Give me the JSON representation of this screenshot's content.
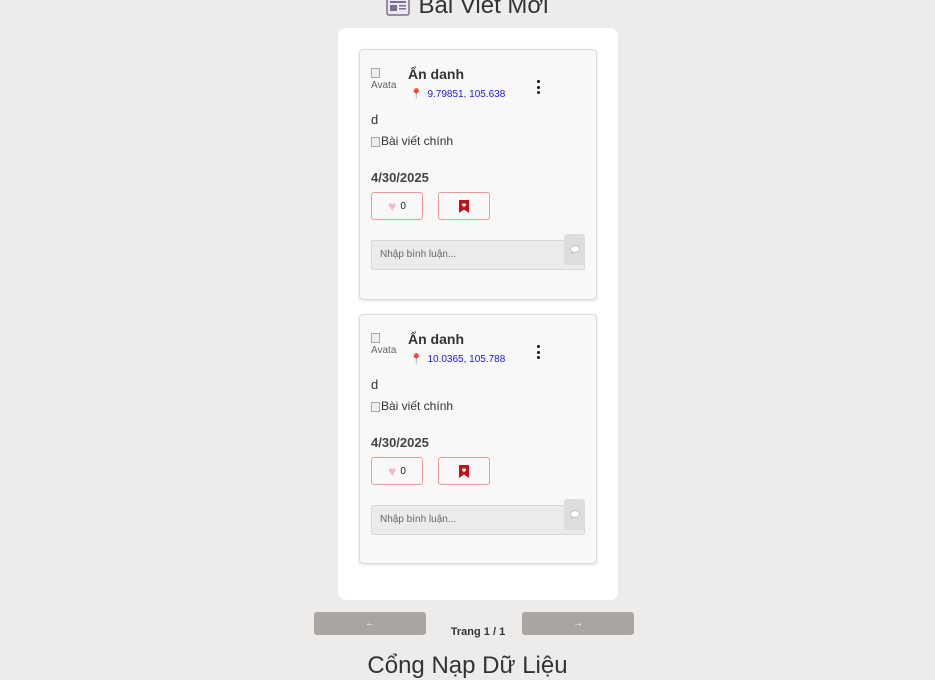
{
  "header": {
    "title": "Bài Viết Mới",
    "icon": "newspaper-icon"
  },
  "posts": [
    {
      "avatar_alt": "Avata",
      "author": "Ẩn danh",
      "location": "9.79851, 105.638",
      "content": "d",
      "image_alt": "Bài viết chính",
      "date": "4/30/2025",
      "like_count": "0",
      "comment_placeholder": "Nhập bình luận..."
    },
    {
      "avatar_alt": "Avata",
      "author": "Ẩn danh",
      "location": "10.0365, 105.788",
      "content": "d",
      "image_alt": "Bài viết chính",
      "date": "4/30/2025",
      "like_count": "0",
      "comment_placeholder": "Nhập bình luận..."
    }
  ],
  "pagination": {
    "prev_label": "←",
    "next_label": "→",
    "page_text": "Trang 1 / 1"
  },
  "next_section_title": "Cổng Nạp Dữ Liệu",
  "colors": {
    "background": "#edecea",
    "location_text": "#1a1ad6",
    "pin": "#e0218a",
    "bookmark": "#c0101a",
    "button_border": "#e99999",
    "pager": "#a8a5a3"
  }
}
